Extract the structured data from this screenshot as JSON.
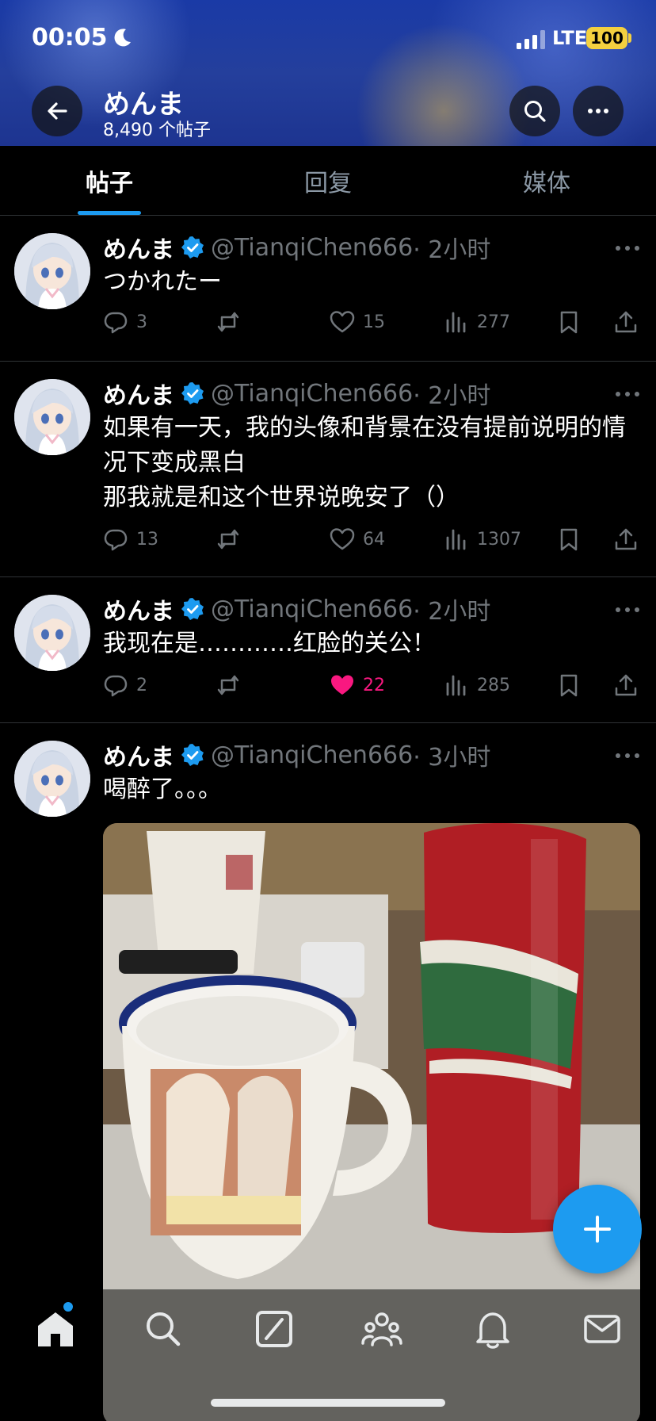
{
  "status_bar": {
    "time": "00:05",
    "network": "LTE",
    "battery": "100"
  },
  "profile": {
    "name": "めんま",
    "post_count": "8,490 个帖子"
  },
  "tabs": [
    {
      "label": "帖子",
      "active": true
    },
    {
      "label": "回复",
      "active": false
    },
    {
      "label": "媒体",
      "active": false
    }
  ],
  "posts": [
    {
      "name": "めんま",
      "handle": "@TianqiChen666",
      "time": "· 2小时",
      "text": "つかれたー",
      "replies": "3",
      "reposts": "",
      "likes": "15",
      "liked": false,
      "views": "277"
    },
    {
      "name": "めんま",
      "handle": "@TianqiChen666",
      "time": "· 2小时",
      "text": "如果有一天，我的头像和背景在没有提前说明的情况下变成黑白\n那我就是和这个世界说晚安了（）",
      "replies": "13",
      "reposts": "",
      "likes": "64",
      "liked": false,
      "views": "1307"
    },
    {
      "name": "めんま",
      "handle": "@TianqiChen666",
      "time": "· 2小时",
      "text": "我现在是…………红脸的关公！",
      "replies": "2",
      "reposts": "",
      "likes": "22",
      "liked": true,
      "views": "285"
    },
    {
      "name": "めんま",
      "handle": "@TianqiChen666",
      "time": "· 3小时",
      "text": "喝醉了。。。",
      "media": "photo-mug-and-beer-can"
    }
  ],
  "colors": {
    "accent": "#1d9bf0",
    "like": "#f91880",
    "muted": "#71767b",
    "background": "#000000"
  },
  "icons": {
    "back": "arrow-left-icon",
    "search": "search-icon",
    "more": "ellipsis-icon",
    "reply": "speech-bubble-icon",
    "repost": "repost-icon",
    "like": "heart-icon",
    "views": "bar-chart-icon",
    "bookmark": "bookmark-icon",
    "share": "share-icon",
    "compose": "plus-icon"
  },
  "bottom_nav": [
    "home-icon",
    "search-icon",
    "grok-icon",
    "communities-icon",
    "bell-icon",
    "mail-icon"
  ]
}
